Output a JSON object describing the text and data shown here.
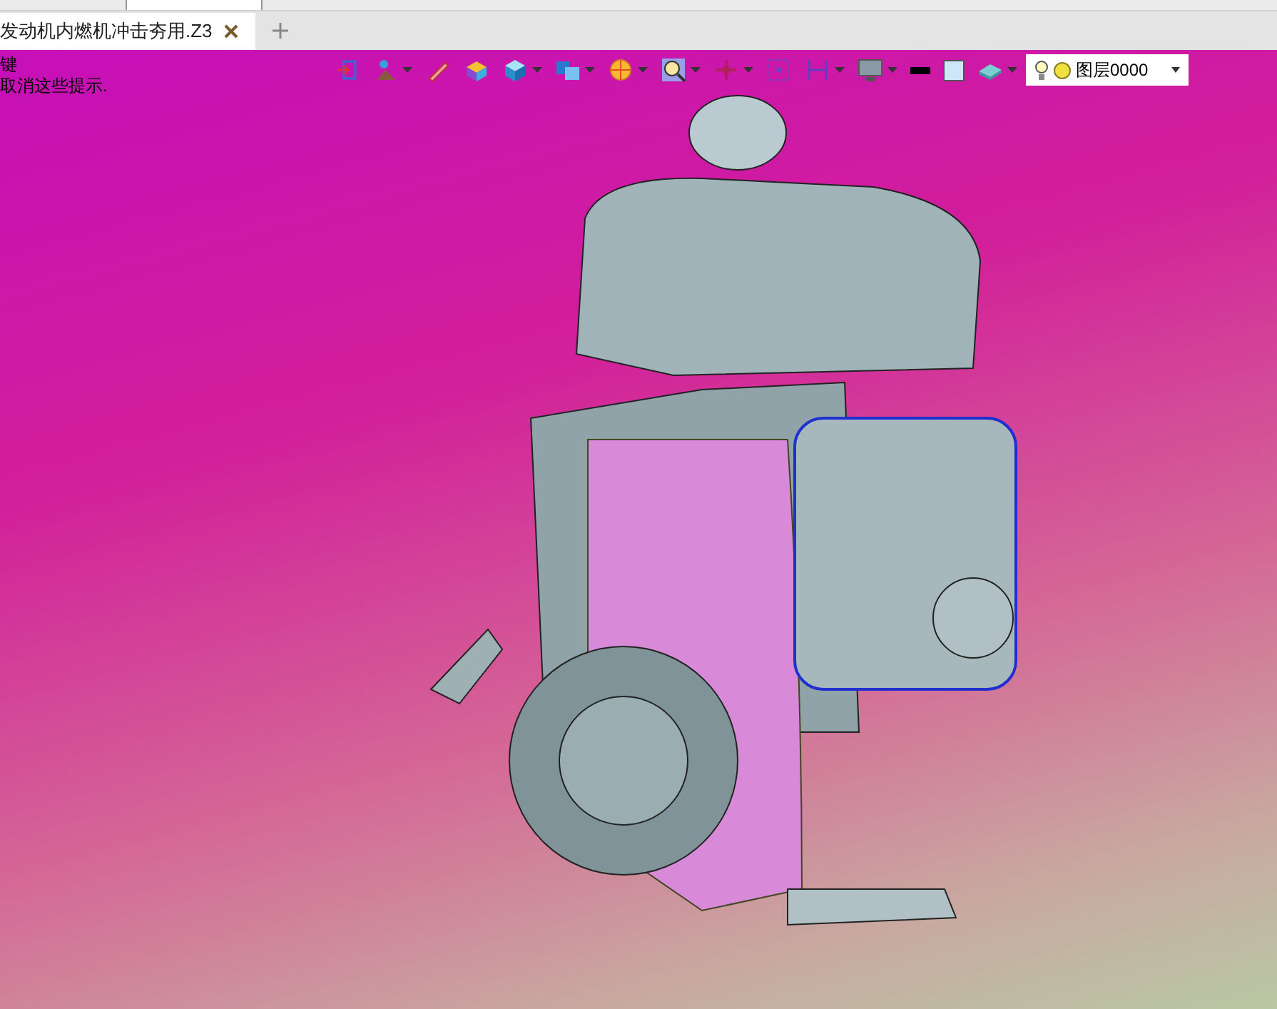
{
  "document_tab": {
    "title": "发动机内燃机冲击夯用.Z3",
    "selected": true
  },
  "hints": [
    "键",
    "取消这些提示."
  ],
  "layer_field": {
    "value": "图层0000"
  }
}
